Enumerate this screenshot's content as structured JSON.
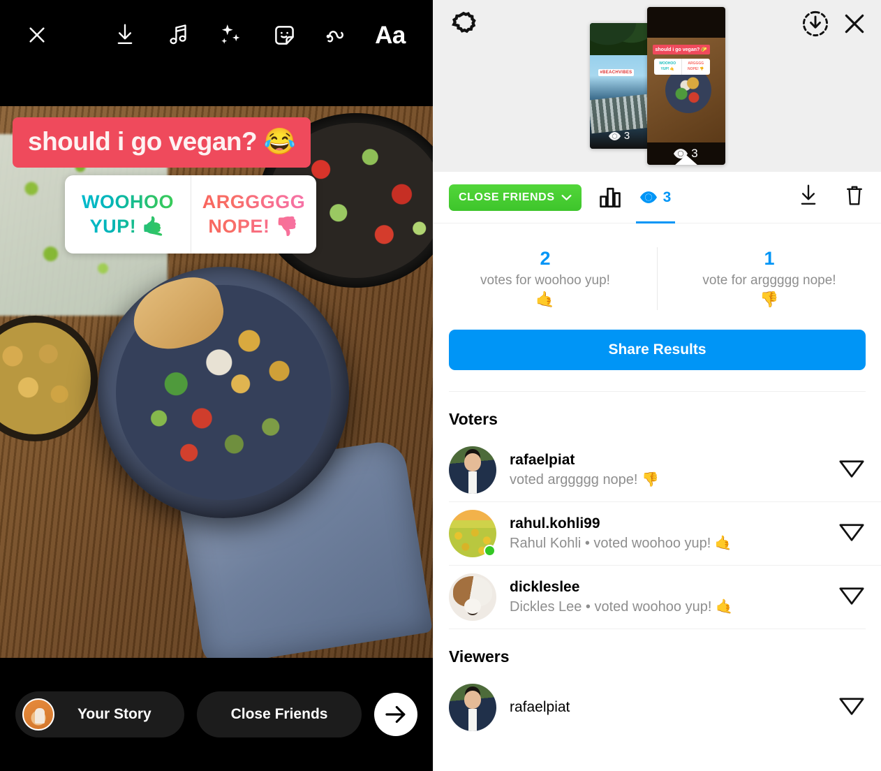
{
  "composer": {
    "toolbar": {
      "close_label": "close-icon",
      "icons": [
        "download-icon",
        "music-icon",
        "effects-icon",
        "sticker-icon",
        "draw-icon"
      ],
      "text_tool_label": "Aa"
    },
    "poll": {
      "question": "should i go vegan? 😂",
      "options": [
        {
          "line1": "WOOHOO",
          "line2": "YUP! 🤙"
        },
        {
          "line1": "ARGGGGG",
          "line2": "NOPE! 👎"
        }
      ]
    },
    "bottom": {
      "your_story_label": "Your Story",
      "close_friends_label": "Close Friends",
      "next_label": "next-arrow"
    }
  },
  "panel": {
    "header": {
      "gear_label": "gear-icon",
      "download_label": "download-circle-icon",
      "close_label": "close-icon",
      "thumbnails": [
        {
          "name": "previous-story",
          "sticker": "#BEACHVIBES",
          "views": "3",
          "selected": false
        },
        {
          "name": "current-story",
          "question": "should i go vegan? 🌮",
          "option_a1": "WOOHOO",
          "option_a2": "YUP! 🤙",
          "option_b1": "ARGGGG",
          "option_b2": "NOPE! 👎",
          "views": "3",
          "selected": true
        }
      ]
    },
    "tabs": {
      "audience_label": "CLOSE FRIENDS",
      "insights_label": "insights-icon",
      "views_count": "3",
      "download_label": "download-icon",
      "delete_label": "trash-icon"
    },
    "poll_results": {
      "options": [
        {
          "count": "2",
          "label": "votes for woohoo yup!",
          "emoji": "🤙"
        },
        {
          "count": "1",
          "label": "vote for arggggg nope!",
          "emoji": "👎"
        }
      ],
      "share_button": "Share Results"
    },
    "voters": {
      "title": "Voters",
      "people": [
        {
          "username": "rafaelpiat",
          "subtitle": "voted arggggg nope! 👎",
          "online": false,
          "avatar": "av-rafael"
        },
        {
          "username": "rahul.kohli99",
          "subtitle": "Rahul Kohli • voted woohoo yup! 🤙",
          "online": true,
          "avatar": "av-rahul"
        },
        {
          "username": "dickleslee",
          "subtitle": "Dickles Lee • voted woohoo yup! 🤙",
          "online": false,
          "avatar": "av-dickles"
        }
      ]
    },
    "viewers": {
      "title": "Viewers",
      "people": [
        {
          "username": "rafaelpiat",
          "subtitle": "",
          "online": false,
          "avatar": "av-rafael"
        }
      ]
    }
  },
  "colors": {
    "instagram_blue": "#0095F6",
    "close_friends_green": "#3EC52B",
    "poll_question_bg": "#EF4A5C",
    "online_green": "#34C724"
  }
}
